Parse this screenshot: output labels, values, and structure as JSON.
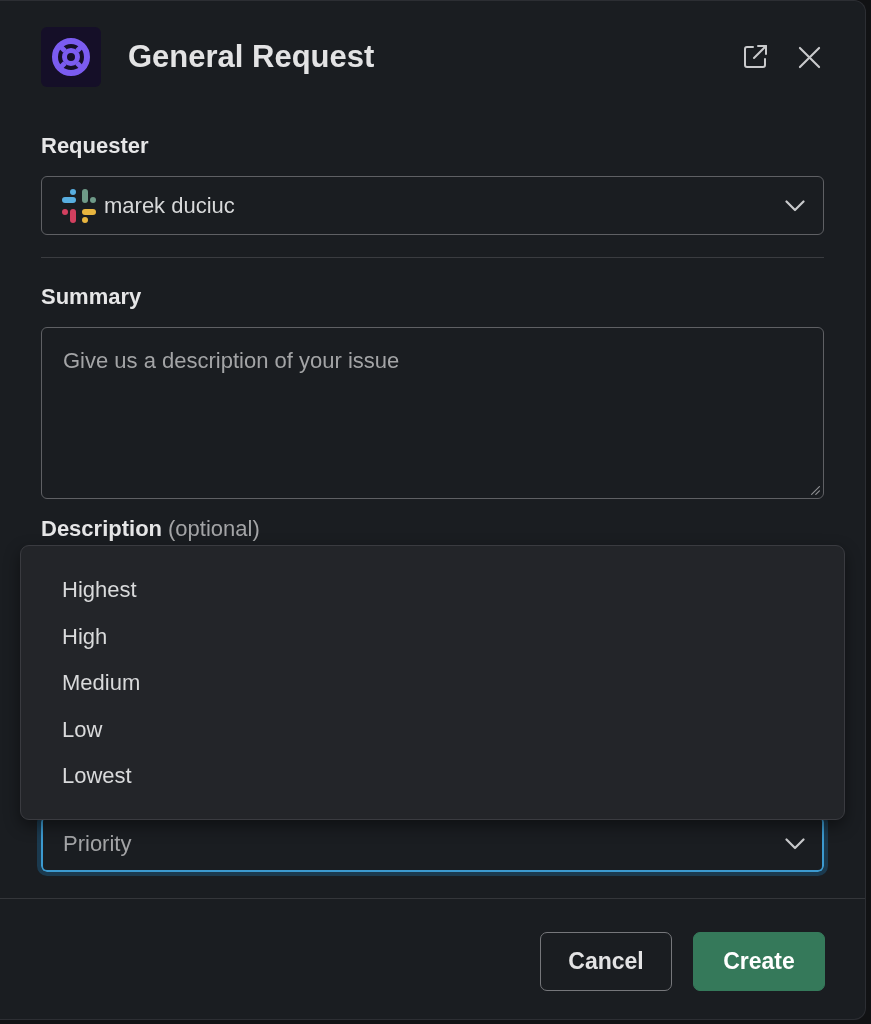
{
  "dialog": {
    "title": "General Request"
  },
  "fields": [
    {
      "kind": "select",
      "label": "Requester",
      "value": "marek duciuc",
      "focused": false
    },
    {
      "kind": "divider"
    },
    {
      "kind": "textarea",
      "label": "Summary",
      "placeholder": "Give us a description of your issue"
    },
    {
      "kind": "label",
      "label": "Description",
      "hint": "(optional)"
    },
    {
      "kind": "select",
      "placeholder": "Priority",
      "focused": true,
      "expanded": true,
      "options": [
        {
          "label": "Highest",
          "selected": false
        },
        {
          "label": "High",
          "selected": false
        },
        {
          "label": "Medium",
          "selected": false
        },
        {
          "label": "Low",
          "selected": false
        },
        {
          "label": "Lowest",
          "selected": false
        }
      ]
    }
  ],
  "buttons": [
    {
      "label": "Cancel",
      "kind": "secondary"
    },
    {
      "label": "Create",
      "kind": "primary"
    }
  ]
}
